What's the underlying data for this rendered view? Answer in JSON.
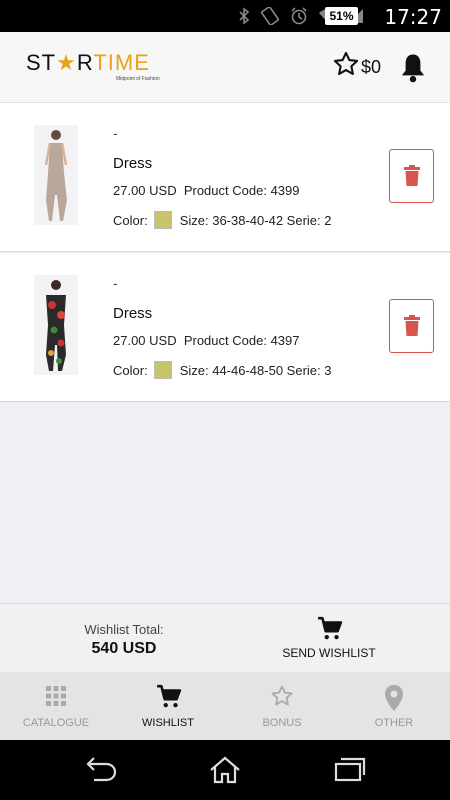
{
  "status_bar": {
    "battery": "51",
    "time": "17:27"
  },
  "header": {
    "logo_st": "ST",
    "logo_star": "★",
    "logo_r": "R",
    "logo_time": "TIME",
    "logo_tagline": "Midpoint of Fashion",
    "balance": "$0"
  },
  "products": [
    {
      "dash": "-",
      "name": "Dress",
      "price": "27.00 USD",
      "code_label": "Product Code:",
      "code": "4399",
      "color_label": "Color:",
      "color": "#c9c46a",
      "size_label": "Size:",
      "size": "36-38-40-42",
      "serie_label": "Serie:",
      "serie": "2"
    },
    {
      "dash": "-",
      "name": "Dress",
      "price": "27.00 USD",
      "code_label": "Product Code:",
      "code": "4397",
      "color_label": "Color:",
      "color": "#c9c46a",
      "size_label": "Size:",
      "size": "44-46-48-50",
      "serie_label": "Serie:",
      "serie": "3"
    }
  ],
  "summary": {
    "total_label": "Wishlist Total:",
    "total_value": "540 USD",
    "send_label": "SEND WISHLIST"
  },
  "tabs": [
    {
      "label": "CATALOGUE",
      "icon": "grid-icon"
    },
    {
      "label": "WISHLIST",
      "icon": "cart-icon",
      "active": true
    },
    {
      "label": "BONUS",
      "icon": "star-icon"
    },
    {
      "label": "OTHER",
      "icon": "location-pin-icon"
    }
  ],
  "colors": {
    "accent_red": "#d9534f",
    "logo_orange": "#e8a317"
  }
}
